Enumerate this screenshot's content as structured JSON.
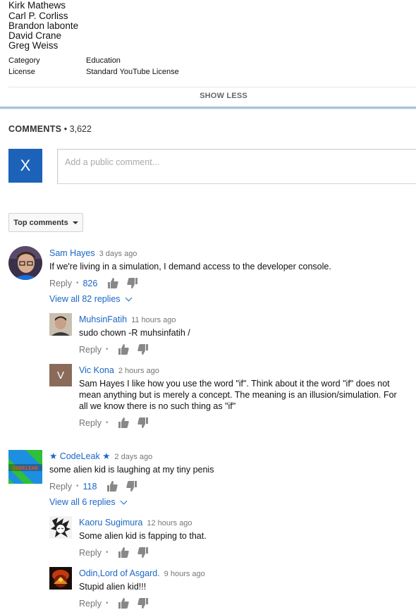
{
  "credits": [
    "Kirk Mathews",
    "Carl P. Corliss",
    "Brandon labonte",
    "David Crane",
    "Greg Weiss"
  ],
  "meta": {
    "category_label": "Category",
    "category_value": "Education",
    "license_label": "License",
    "license_value": "Standard YouTube License"
  },
  "show_less": "SHOW LESS",
  "comments": {
    "title": "COMMENTS",
    "separator": "•",
    "count": "3,622",
    "user_initial": "X",
    "placeholder": "Add a public comment...",
    "sort_label": "Top comments"
  },
  "threads": [
    {
      "author": "Sam Hayes",
      "time": "3 days ago",
      "text": "If we're living in a simulation, I demand access to the developer console.",
      "reply": "Reply",
      "likes": "826",
      "view_replies": "View all 82 replies",
      "replies": [
        {
          "author": "MuhsinFatih",
          "time": "11 hours ago",
          "text": "sudo chown -R muhsinfatih /",
          "reply": "Reply"
        },
        {
          "author": "Vic Kona",
          "time": "2 hours ago",
          "avatar_initial": "V",
          "text_lines": [
            "Sam Hayes I like how you use the word \"if\". Think about it the word \"if\" does not",
            "mean anything but is merely a concept. The meaning is an illusion/simulation. For",
            "all we know there is no such thing as \"if\""
          ],
          "reply": "Reply"
        }
      ]
    },
    {
      "author_star_left": "★",
      "author": "CodeLeak",
      "author_star_right": "★",
      "avatar_text": "CODELEAK",
      "time": "2 days ago",
      "text": "some alien kid is laughing at my tiny penis",
      "reply": "Reply",
      "likes": "118",
      "view_replies": "View all 6 replies",
      "replies": [
        {
          "author": "Kaoru Sugimura",
          "time": "12 hours ago",
          "text": "Some alien kid is fapping to that.",
          "reply": "Reply"
        },
        {
          "author": "Odin,Lord of Asgard.",
          "time": "9 hours ago",
          "text": "Stupid alien kid!!!",
          "reply": "Reply"
        }
      ]
    }
  ],
  "colors": {
    "link": "#1a66c5",
    "avatar_x": "#1c62b9",
    "avatar_v": "#8a6b5a"
  },
  "icons": [
    "thumbs-up-icon",
    "thumbs-down-icon",
    "chevron-down-icon",
    "caret-down-icon"
  ]
}
